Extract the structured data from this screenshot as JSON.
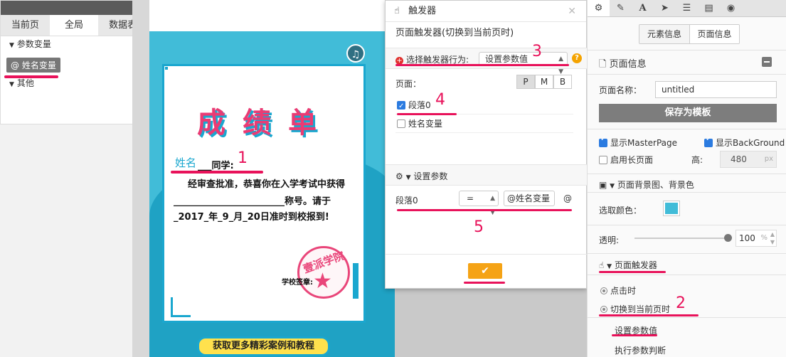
{
  "vars_panel": {
    "tabs": [
      "当前页",
      "全局",
      "数据表"
    ],
    "active_tab": 1,
    "section_params": "参数变量",
    "variable_chip": "@ 姓名变量",
    "section_other": "其他"
  },
  "canvas": {
    "certificate": {
      "title": "成绩单",
      "name": "姓名",
      "classmate": "___同学:",
      "line1": "经审查批准，恭喜你在入学考试中获得",
      "line2": "________________________称号。请于",
      "line3": "_2017_年_9_月_20日准时到校报到!",
      "sign_label": "学校签章:",
      "stamp_text": "壹派学院"
    },
    "cta_label": "获取更多精彩案例和教程",
    "music_icon": "music-note-icon"
  },
  "trigger_dialog": {
    "title": "触发器",
    "subtitle": "页面触发器(切换到当前页时)",
    "action_label": "选择触发器行为:",
    "action_value": "设置参数值",
    "help": "?",
    "page_label": "页面：",
    "device_buttons": [
      "P",
      "M",
      "B"
    ],
    "page_items": [
      {
        "label": "段落0",
        "checked": true
      },
      {
        "label": "姓名变量",
        "checked": false
      }
    ],
    "set_params_label": "设置参数",
    "param_name": "段落0",
    "operator": "=",
    "param_value": "@姓名变量",
    "at_label": "@",
    "confirm_icon": "checkmark-icon"
  },
  "prop_panel": {
    "tabs": [
      "gear",
      "pencil",
      "A",
      "send",
      "list",
      "doc",
      "db"
    ],
    "segments": [
      "元素信息",
      "页面信息"
    ],
    "active_segment": 1,
    "section_title": "页面信息",
    "name_label": "页面名称：",
    "name_value": "untitled",
    "save_template": "保存为模板",
    "show_master": "显示MasterPage",
    "show_background": "显示BackGround",
    "enable_long": "启用长页面",
    "height_label": "高:",
    "height_value": "480",
    "height_unit": "px",
    "bg_section": "页面背景图、背景色",
    "pick_color": "选取颜色：",
    "opacity_label": "透明:",
    "opacity_value": "100",
    "opacity_unit": "%",
    "trigger_section": "页面触发器",
    "trigger_items": [
      "点击时",
      "切换到当前页时"
    ],
    "sub_items": [
      "设置参数值",
      "执行参数判断"
    ]
  },
  "annotations": [
    "1",
    "2",
    "3",
    "4",
    "5"
  ],
  "colors": {
    "accent": "#1aa7cf",
    "annotation": "#e8125a",
    "confirm": "#f5a315",
    "swatch": "#41bcd8"
  }
}
